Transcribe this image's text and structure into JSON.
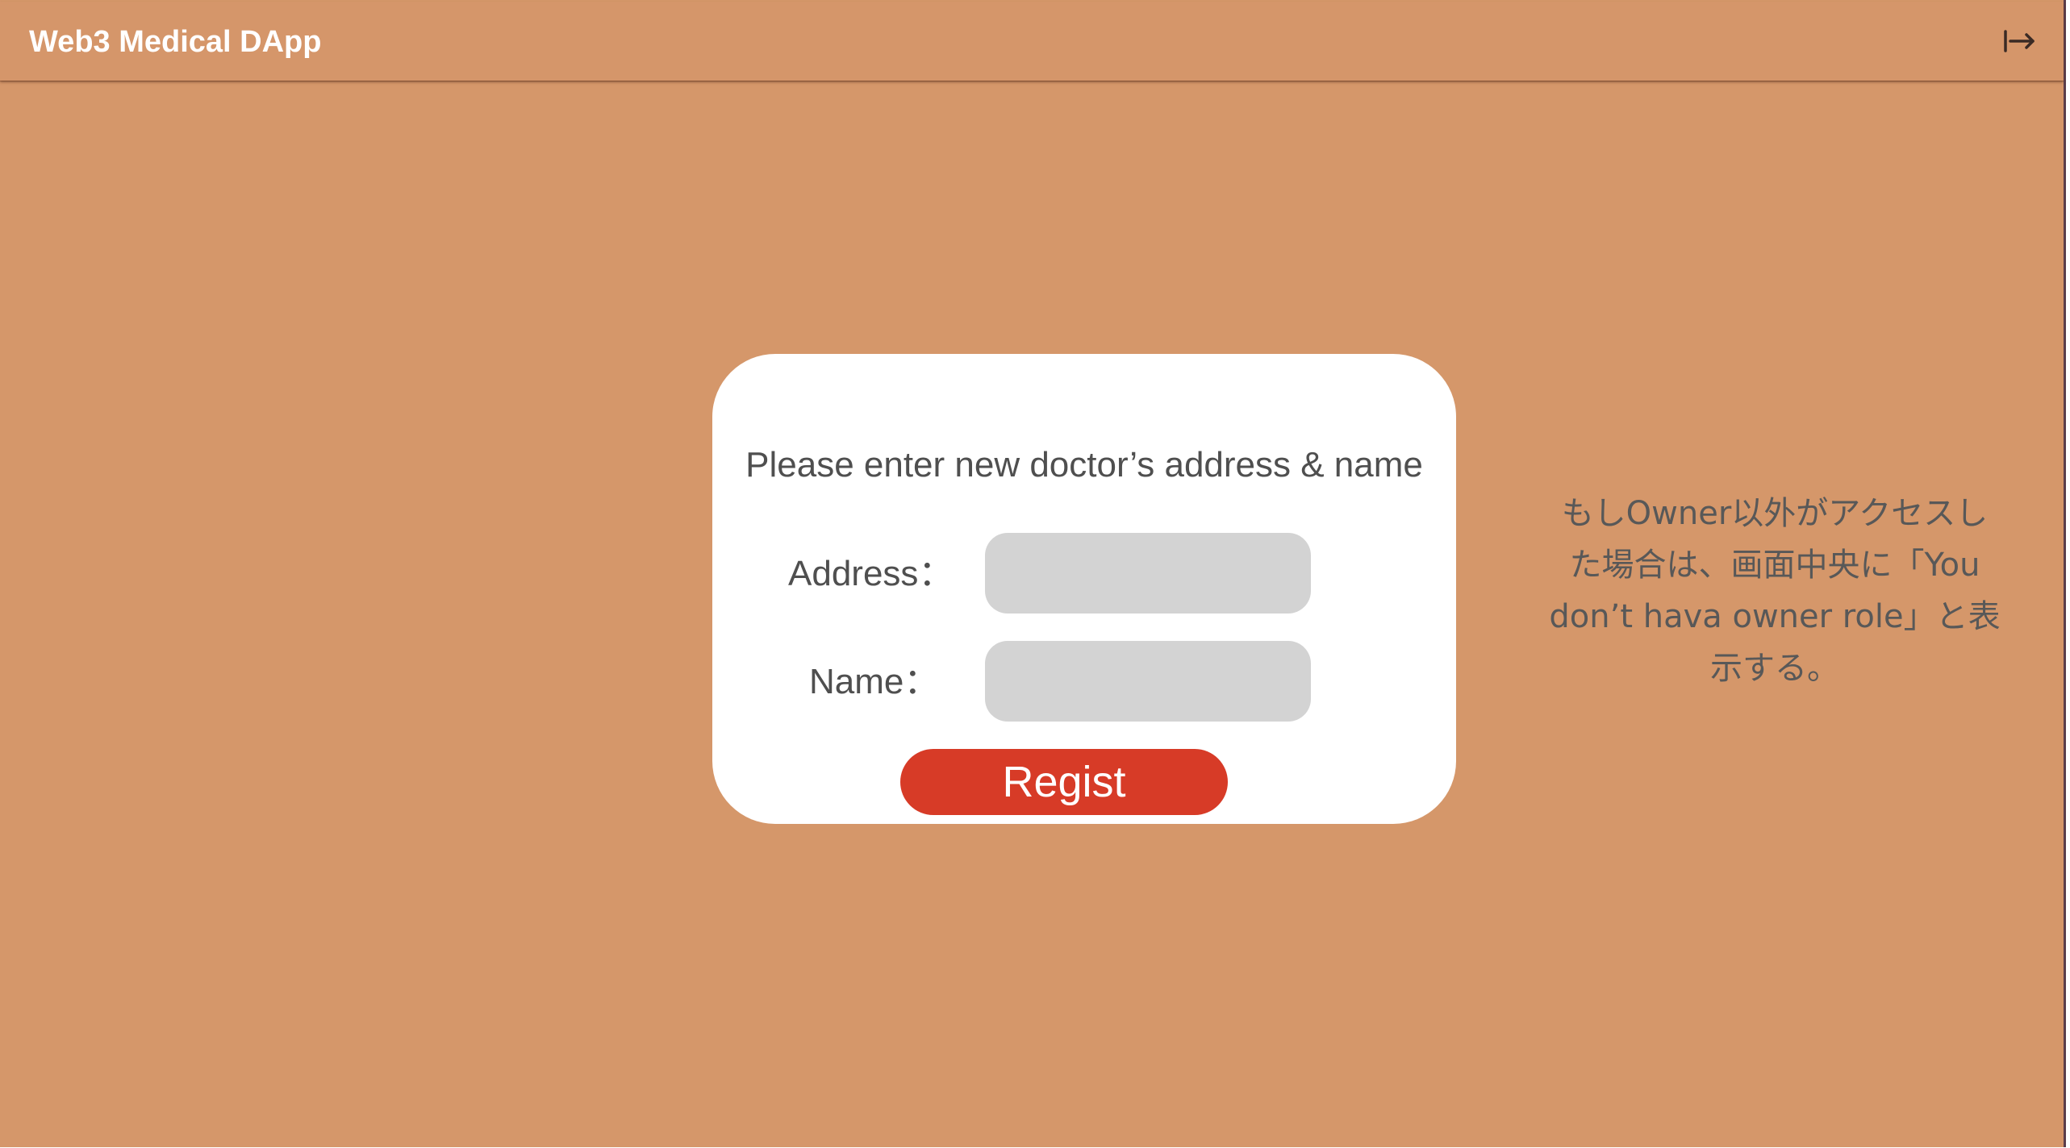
{
  "app": {
    "title": "Web3 Medical DApp",
    "logout_icon": "logout-arrow-icon"
  },
  "form": {
    "heading": "Please enter new doctor’s address & name",
    "address_label": "Address：",
    "address_value": "",
    "name_label": "Name：",
    "name_value": "",
    "submit_label": "Regist"
  },
  "note": {
    "line1": "もしOwner以外がアクセスし",
    "line2": "た場合は、画面中央に「You",
    "line3": "don’t hava owner role」と表",
    "line4": "示する。"
  },
  "colors": {
    "background": "#d5976a",
    "card": "#ffffff",
    "input": "#d3d3d3",
    "button": "#d73b27",
    "text": "#4f4f4f"
  }
}
